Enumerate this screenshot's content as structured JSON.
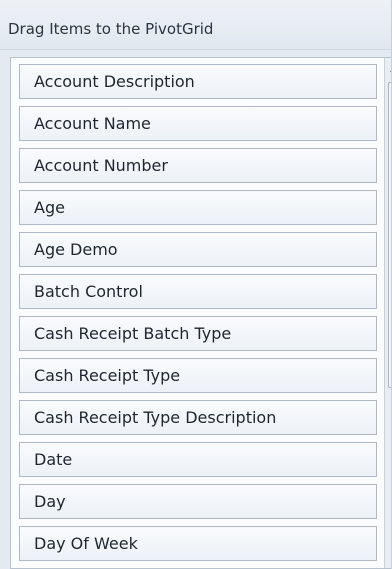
{
  "header": {
    "title": "Drag Items to the PivotGrid"
  },
  "fields": [
    {
      "label": "Account Description"
    },
    {
      "label": "Account Name"
    },
    {
      "label": "Account Number"
    },
    {
      "label": "Age"
    },
    {
      "label": "Age Demo"
    },
    {
      "label": "Batch Control"
    },
    {
      "label": "Cash Receipt Batch Type"
    },
    {
      "label": "Cash Receipt Type"
    },
    {
      "label": "Cash Receipt Type Description"
    },
    {
      "label": "Date"
    },
    {
      "label": "Day"
    },
    {
      "label": "Day Of Week"
    }
  ],
  "scrollbar": {
    "up_icon": "triangle-up-icon",
    "grip_icon": "grip-lines-icon"
  }
}
